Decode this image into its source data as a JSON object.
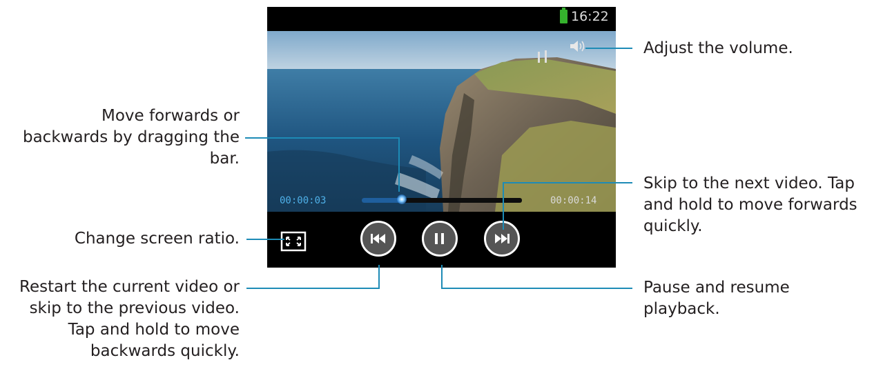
{
  "status_bar": {
    "time": "16:22"
  },
  "player": {
    "elapsed": "00:00:03",
    "total": "00:00:14",
    "progress": 0.25
  },
  "callouts": {
    "volume": "Adjust the volume.",
    "seek": [
      "Move forwards or",
      "backwards by dragging the",
      "bar."
    ],
    "ratio": "Change screen ratio.",
    "previous": [
      "Restart the current video or",
      "skip to the previous video.",
      "Tap and hold to move",
      "backwards quickly."
    ],
    "next": [
      "Skip to the next video. Tap",
      "and hold to move forwards",
      "quickly."
    ],
    "pause": [
      "Pause and resume",
      "playback."
    ]
  },
  "icons": {
    "volume": "speaker-icon",
    "ratio": "screen-ratio-icon",
    "previous": "skip-previous-icon",
    "pause": "pause-icon",
    "next": "skip-next-icon"
  },
  "colors": {
    "accent": "#4fb0e8",
    "leader_lines": "#1d8bb6",
    "battery": "#35b22d"
  }
}
